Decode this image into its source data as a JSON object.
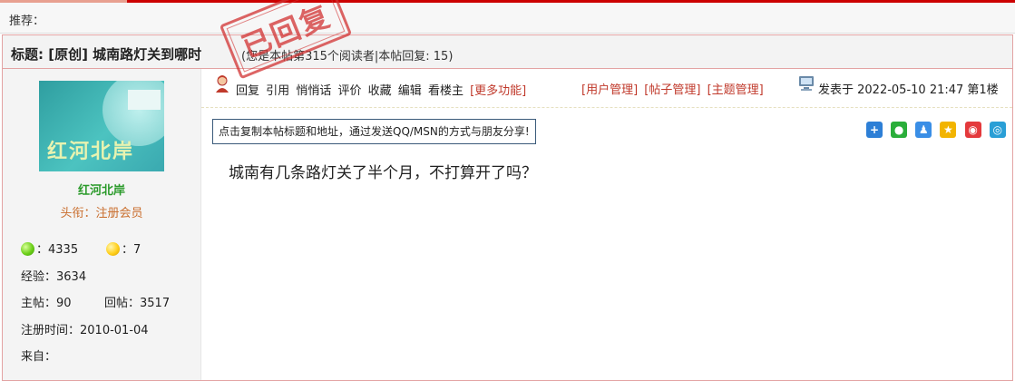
{
  "recommend": {
    "label": "推荐："
  },
  "post": {
    "title": "标题: [原创] 城南路灯关到哪时",
    "stats": "(您是本帖第315个阅读者|本帖回复: 15)",
    "stamp": "已回复",
    "author": {
      "name": "红河北岸",
      "avatar_text": "红河北岸",
      "title": "头衔：注册会员",
      "green_points": "：4335",
      "yellow_points": "：7",
      "experience": "经验：3634",
      "topics_label": "主帖：",
      "topics": "90",
      "replies_label": "回帖：",
      "replies": "3517",
      "registered": "注册时间：2010-01-04",
      "from": "来自："
    },
    "actions": [
      "回复",
      "引用",
      "悄悄话",
      "评价",
      "收藏",
      "编辑",
      "看楼主"
    ],
    "more_functions": "[更多功能]",
    "management": [
      "[用户管理]",
      "[帖子管理]",
      "[主题管理]"
    ],
    "posted": "发表于 2022-05-10 21:47 第1楼",
    "share_button": "点击复制本帖标题和地址，通过发送QQ/MSN的方式与朋友分享!",
    "share_icons": [
      {
        "name": "add-share-icon",
        "color": "#2d7fd6"
      },
      {
        "name": "wechat-icon",
        "color": "#2aae3a"
      },
      {
        "name": "qq-icon",
        "color": "#3a8ee6"
      },
      {
        "name": "qzone-icon",
        "color": "#f2b400"
      },
      {
        "name": "weibo-icon",
        "color": "#e4393c"
      },
      {
        "name": "tencent-weibo-icon",
        "color": "#2a9fd6"
      }
    ],
    "body": "城南有几条路灯关了半个月，不打算开了吗？"
  },
  "colors": {
    "accent_red": "#cc0000",
    "link_red": "#c0392b",
    "username_green": "#2a9a2a",
    "title_orange": "#c96d2c"
  }
}
